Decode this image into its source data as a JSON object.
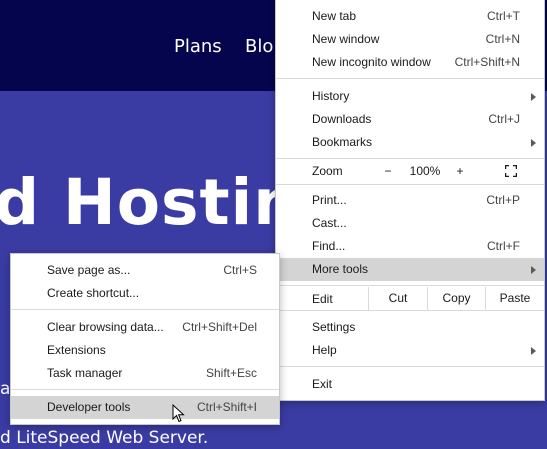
{
  "page": {
    "nav": {
      "plans": "Plans",
      "blog_fragment": "Blo"
    },
    "hero_title": "d Hostin",
    "hero_fragment": "a",
    "hero_subtitle": "d LiteSpeed Web Server.",
    "colors": {
      "header_bg": "#05054e",
      "hero_bg": "#3a3ca3"
    }
  },
  "menu": {
    "new_tab": {
      "label": "New tab",
      "shortcut": "Ctrl+T"
    },
    "new_window": {
      "label": "New window",
      "shortcut": "Ctrl+N"
    },
    "new_incognito": {
      "label": "New incognito window",
      "shortcut": "Ctrl+Shift+N"
    },
    "history": {
      "label": "History"
    },
    "downloads": {
      "label": "Downloads",
      "shortcut": "Ctrl+J"
    },
    "bookmarks": {
      "label": "Bookmarks"
    },
    "zoom": {
      "label": "Zoom",
      "minus": "−",
      "value": "100%",
      "plus": "+",
      "fullscreen_icon": "fullscreen-icon"
    },
    "print": {
      "label": "Print...",
      "shortcut": "Ctrl+P"
    },
    "cast": {
      "label": "Cast..."
    },
    "find": {
      "label": "Find...",
      "shortcut": "Ctrl+F"
    },
    "more_tools": {
      "label": "More tools"
    },
    "edit": {
      "label": "Edit",
      "cut": "Cut",
      "copy": "Copy",
      "paste": "Paste"
    },
    "settings": {
      "label": "Settings"
    },
    "help": {
      "label": "Help"
    },
    "exit": {
      "label": "Exit"
    }
  },
  "submenu": {
    "save_page": {
      "label": "Save page as...",
      "shortcut": "Ctrl+S"
    },
    "create_shortcut": {
      "label": "Create shortcut..."
    },
    "clear_browsing": {
      "label": "Clear browsing data...",
      "shortcut": "Ctrl+Shift+Del"
    },
    "extensions": {
      "label": "Extensions"
    },
    "task_manager": {
      "label": "Task manager",
      "shortcut": "Shift+Esc"
    },
    "developer_tools": {
      "label": "Developer tools",
      "shortcut": "Ctrl+Shift+I"
    }
  }
}
